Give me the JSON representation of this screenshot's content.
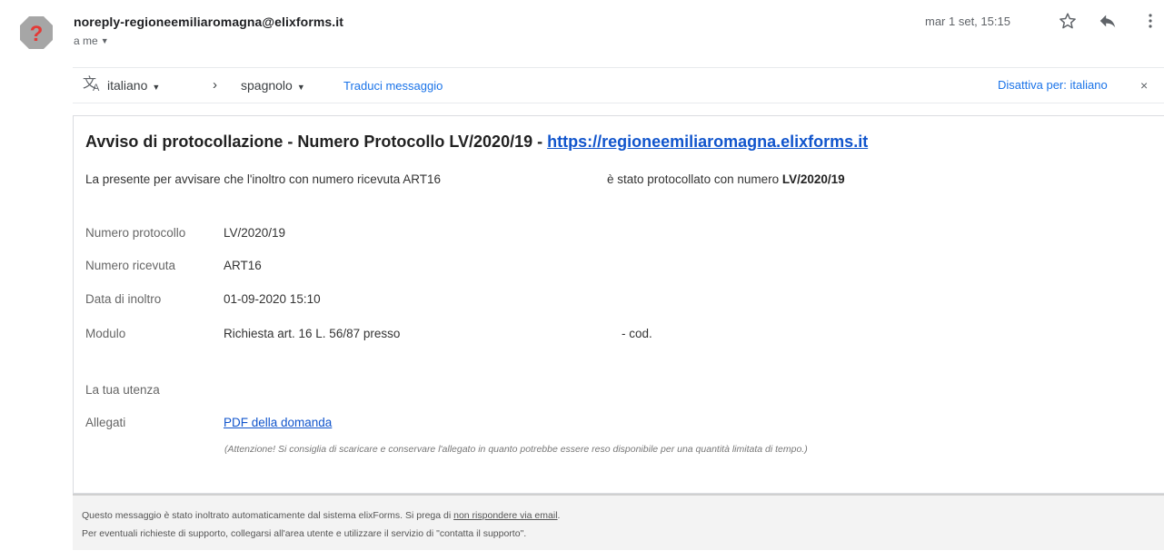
{
  "sender": {
    "email": "noreply-regioneemiliaromagna@elixforms.it",
    "recipient": "a me",
    "date": "mar 1 set, 15:15"
  },
  "translate_bar": {
    "source_language": "italiano",
    "target_language": "spagnolo",
    "translate_link": "Traduci messaggio",
    "disable_link": "Disattiva per: italiano"
  },
  "message": {
    "subject_text": "Avviso di protocollazione - Numero Protocollo LV/2020/19 - ",
    "subject_link": "https://regioneemiliaromagna.elixforms.it",
    "intro_part1": "La presente per avvisare che l'inoltro con numero ricevuta ART16",
    "intro_part2": "è stato protocollato con numero ",
    "intro_bold": "LV/2020/19",
    "fields": [
      {
        "label": "Numero protocollo",
        "value": "LV/2020/19"
      },
      {
        "label": "Numero ricevuta",
        "value": "ART16"
      },
      {
        "label": "Data di inoltro",
        "value": "01-09-2020 15:10"
      },
      {
        "label": "Modulo",
        "value": "Richiesta art. 16 L. 56/87 presso",
        "value_suffix": "- cod."
      },
      {
        "label": "La tua utenza",
        "value": ""
      },
      {
        "label": "Allegati",
        "value": "PDF della domanda"
      }
    ],
    "attachment_note": "(Attenzione! Si consiglia di scaricare e conservare l'allegato in quanto potrebbe essere reso disponibile per una quantità limitata di tempo.)"
  },
  "footer": {
    "line1_text": "Questo messaggio è stato inoltrato automaticamente dal sistema elixForms. Si prega di ",
    "line1_link": "non rispondere via email",
    "line1_end": ".",
    "line2": "Per eventuali richieste di supporto, collegarsi all'area utente e utilizzare il servizio di \"contatta il supporto\"."
  },
  "icons": {
    "avatar": "unknown-sender-warning-icon",
    "star": "star-icon",
    "reply": "reply-icon",
    "more": "more-vertical-icon",
    "translate": "translate-icon",
    "close": "close-icon"
  },
  "colors": {
    "avatar_bg": "#a6a6a6",
    "avatar_mark": "#e53935",
    "link_blue": "#1a73e8",
    "mail_link": "#1155cc",
    "footer_bg": "#f3f3f3"
  }
}
